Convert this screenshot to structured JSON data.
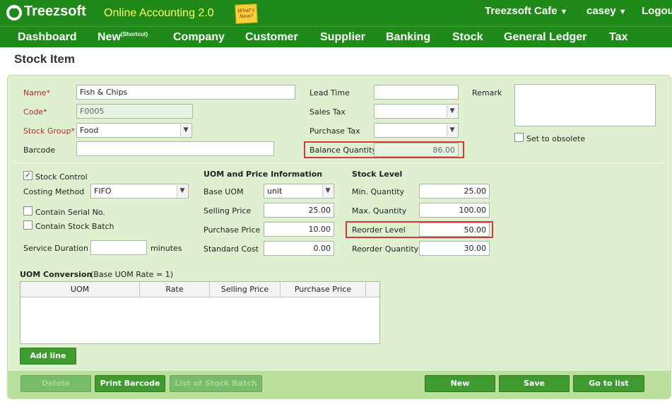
{
  "header": {
    "logo": "Treezsoft",
    "tagline": "Online Accounting 2.0",
    "whats_new": "What's New?",
    "company": "Treezsoft Cafe",
    "user": "casey",
    "logout": "Logou"
  },
  "nav": {
    "dashboard": "Dashboard",
    "new": "New",
    "new_sup": "(Shortcut)",
    "company": "Company",
    "customer": "Customer",
    "supplier": "Supplier",
    "banking": "Banking",
    "stock": "Stock",
    "general_ledger": "General Ledger",
    "tax": "Tax"
  },
  "page_title": "Stock Item",
  "form": {
    "name_label": "Name*",
    "name_value": "Fish & Chips",
    "code_label": "Code*",
    "code_value": "F0005",
    "stock_group_label": "Stock Group*",
    "stock_group_value": "Food",
    "barcode_label": "Barcode",
    "barcode_value": "",
    "lead_time_label": "Lead Time",
    "lead_time_value": "",
    "sales_tax_label": "Sales Tax",
    "sales_tax_value": "",
    "purchase_tax_label": "Purchase Tax",
    "purchase_tax_value": "",
    "balance_qty_label": "Balance Quantity",
    "balance_qty_value": "86.00",
    "remark_label": "Remark",
    "remark_value": "",
    "obsolete_label": "Set to obsolete",
    "obsolete_checked": false
  },
  "stock": {
    "stock_control_label": "Stock Control",
    "stock_control_checked": true,
    "costing_method_label": "Costing Method",
    "costing_method_value": "FIFO",
    "serial_label": "Contain Serial No.",
    "batch_label": "Contain Stock Batch",
    "service_duration_label": "Service Duration",
    "service_duration_value": "",
    "minutes_label": "minutes"
  },
  "uom": {
    "heading": "UOM and Price Information",
    "base_uom_label": "Base UOM",
    "base_uom_value": "unit",
    "selling_price_label": "Selling Price",
    "selling_price_value": "25.00",
    "purchase_price_label": "Purchase Price",
    "purchase_price_value": "10.00",
    "standard_cost_label": "Standard Cost",
    "standard_cost_value": "0.00"
  },
  "stock_level": {
    "heading": "Stock Level",
    "min_qty_label": "Min. Quantity",
    "min_qty_value": "25.00",
    "max_qty_label": "Max. Quantity",
    "max_qty_value": "100.00",
    "reorder_level_label": "Reorder Level",
    "reorder_level_value": "50.00",
    "reorder_qty_label": "Reorder Quantity",
    "reorder_qty_value": "30.00"
  },
  "uom_conversion": {
    "heading": "UOM Conversion",
    "note": "(Base UOM Rate = 1)",
    "columns": [
      "UOM",
      "Rate",
      "Selling Price",
      "Purchase Price"
    ],
    "rows": [],
    "add_line": "Add line"
  },
  "actions": {
    "delete": "Delete",
    "print_barcode": "Print Barcode",
    "list_stock_batch": "List of Stock Batch",
    "new": "New",
    "save": "Save",
    "go_to_list": "Go to list"
  },
  "colors": {
    "brand_green": "#1f8a1a",
    "tagline_yellow": "#ffff66",
    "panel_bg": "#dff0d1",
    "highlight_red": "#d23a3a"
  }
}
